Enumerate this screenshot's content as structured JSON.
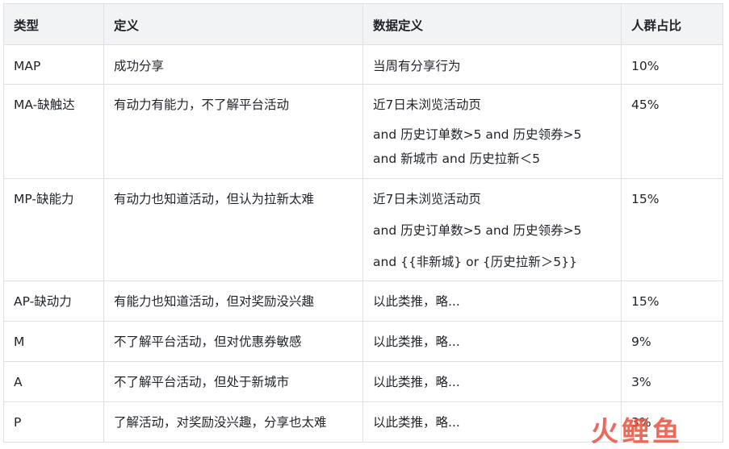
{
  "table": {
    "headers": [
      "类型",
      "定义",
      "数据定义",
      "人群占比"
    ],
    "rows": [
      {
        "type": "MAP",
        "definition": "成功分享",
        "data_def": [
          "当周有分享行为"
        ],
        "share": "10%"
      },
      {
        "type": "MA-缺触达",
        "definition": "有动力有能力，不了解平台活动",
        "data_def": [
          "近7日未浏览活动页",
          "and 历史订单数>5  and 历史领券>5",
          "and 新城市 and 历史拉新＜5"
        ],
        "share": "45%"
      },
      {
        "type": "MP-缺能力",
        "definition": "有动力也知道活动，但认为拉新太难",
        "data_def": [
          "近7日未浏览活动页",
          "and 历史订单数>5  and 历史领券>5",
          "and {{非新城} or {历史拉新＞5}}"
        ],
        "share": "15%"
      },
      {
        "type": "AP-缺动力",
        "definition": "有能力也知道活动，但对奖励没兴趣",
        "data_def": [
          "以此类推，略..."
        ],
        "share": "15%"
      },
      {
        "type": "M",
        "definition": "不了解平台活动，但对优惠券敏感",
        "data_def": [
          "以此类推，略..."
        ],
        "share": "9%"
      },
      {
        "type": "A",
        "definition": "不了解平台活动，但处于新城市",
        "data_def": [
          "以此类推，略..."
        ],
        "share": "3%"
      },
      {
        "type": "P",
        "definition": "了解活动，对奖励没兴趣，分享也太难",
        "data_def": [
          "以此类推，略..."
        ],
        "share": "3%"
      }
    ]
  },
  "watermark": {
    "chars": [
      "火",
      "鲤",
      "鱼"
    ]
  }
}
